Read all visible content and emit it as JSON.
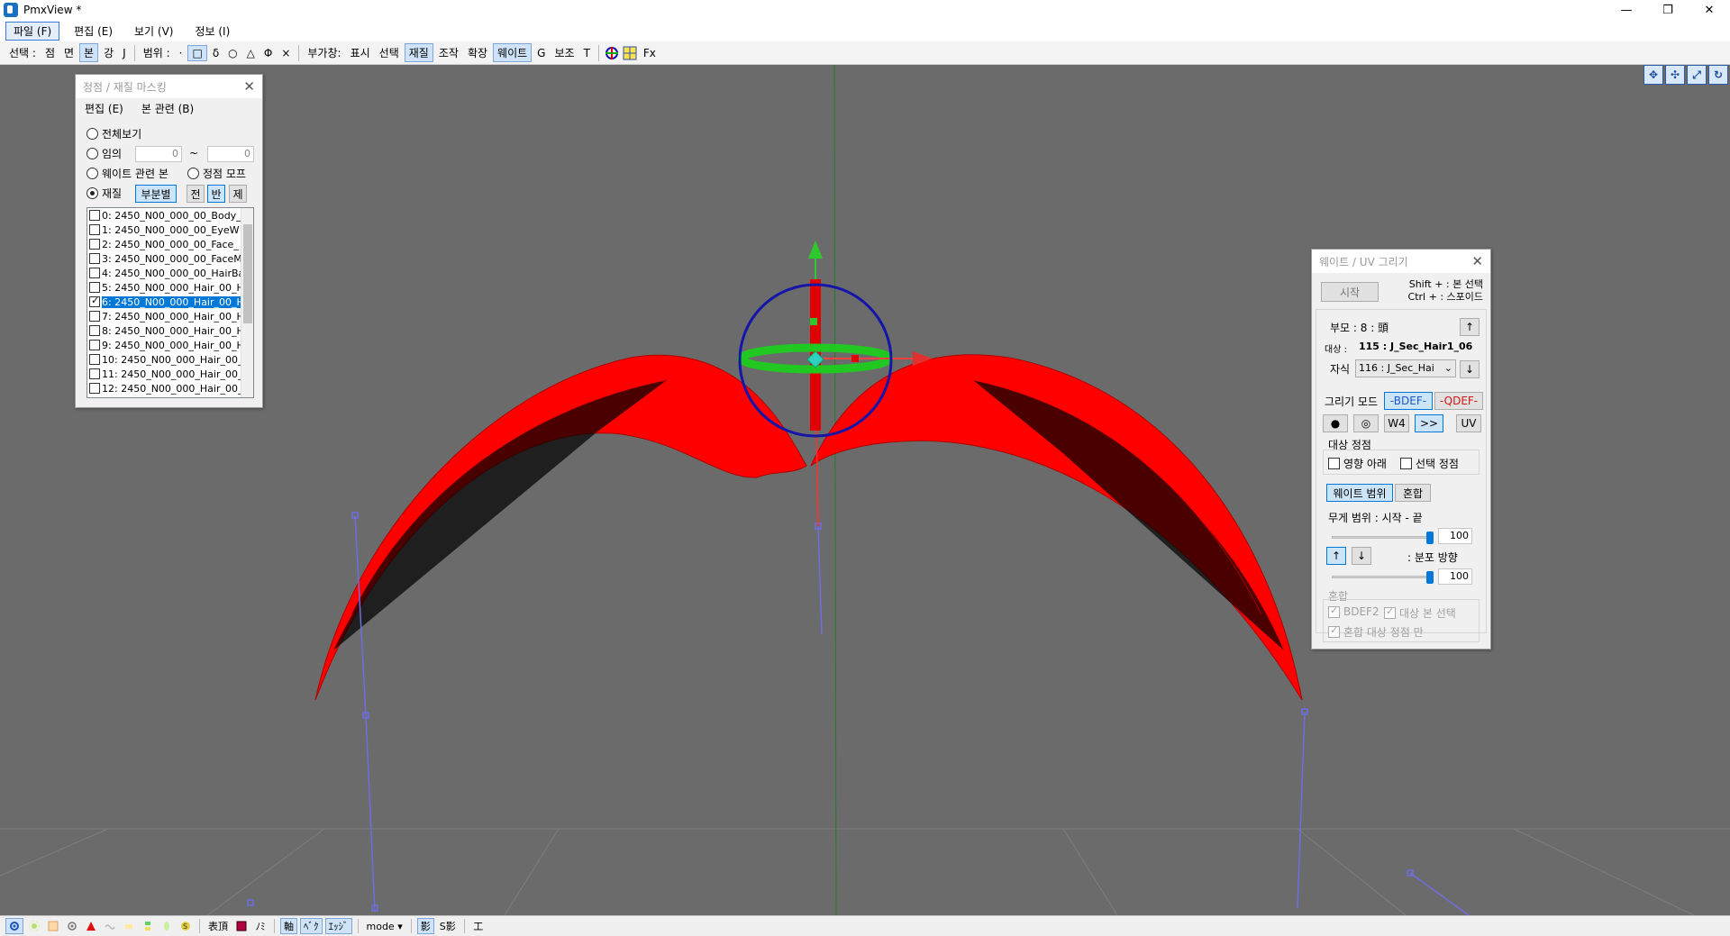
{
  "window": {
    "title": "PmxView *",
    "minimize": "—",
    "restore": "❐",
    "close": "✕"
  },
  "menu": [
    {
      "label": "파일 (F)"
    },
    {
      "label": "편집 (E)"
    },
    {
      "label": "보기 (V)"
    },
    {
      "label": "정보 (I)"
    }
  ],
  "toolbar": {
    "select_label": "선택 :",
    "vertex": "점",
    "face": "면",
    "bone": "본",
    "strong": "강",
    "j": "J",
    "range_label": "범위 :",
    "r_dot": "·",
    "r_box": "□",
    "r_delta": "δ",
    "r_circle": "○",
    "r_tri": "△",
    "r_phi": "Φ",
    "r_x": "×",
    "extra_label": "부가창:",
    "display": "표시",
    "selection": "선택",
    "material": "재질",
    "control": "조작",
    "expand": "확장",
    "weight": "웨이트",
    "g": "G",
    "assist": "보조",
    "t": "T",
    "fx": "Fx"
  },
  "mask_panel": {
    "title": "정점 / 재질 마스킹",
    "menu_edit": "편집 (E)",
    "menu_bone": "본 관련 (B)",
    "opt_all": "전체보기",
    "opt_range": "임의",
    "range_from": "0",
    "range_sep": "~",
    "range_to": "0",
    "opt_weight_bone": "웨이트 관련 본",
    "opt_vertex_morph": "정점 모프",
    "opt_material": "재질",
    "btn_partial": "부분별",
    "btn_all": "전",
    "btn_half": "반",
    "btn_remove": "제",
    "materials": [
      "0: 2450_N00_000_00_Body_",
      "1: 2450_N00_000_00_EyeW",
      "2: 2450_N00_000_00_Face_",
      "3: 2450_N00_000_00_FaceM",
      "4: 2450_N00_000_00_HairBa",
      "5: 2450_N00_000_Hair_00_H",
      "6: 2450_N00_000_Hair_00_H",
      "7: 2450_N00_000_Hair_00_H",
      "8: 2450_N00_000_Hair_00_H",
      "9: 2450_N00_000_Hair_00_H",
      "10: 2450_N00_000_Hair_00_",
      "11: 2450_N00_000_Hair_00_",
      "12: 2450_N00_000_Hair_00_"
    ]
  },
  "weight_panel": {
    "title": "웨이트 / UV 그리기",
    "btn_start": "시작",
    "hint1": "Shift + : 본 선택",
    "hint2": "Ctrl + : 스포이드",
    "parent": "부모 : 8 : 頭",
    "target_label": "대상 :",
    "target": "115 : J_Sec_Hair1_06",
    "child_label": "자식",
    "child": "116 : J_Sec_Hai",
    "up": "↑",
    "down": "↓",
    "draw_mode": "그리기 모드",
    "bdef": "-BDEF-",
    "qdef": "-QDEF-",
    "dot": "●",
    "target_dot": "◎",
    "w4": "W4",
    "next": ">>",
    "uv": "UV",
    "target_vertex": "대상 정점",
    "under_influence": "영향 아래",
    "selected_vertex": "선택 정점",
    "tab_weight_range": "웨이트 범위",
    "tab_blend": "혼합",
    "weight_range": "무게 범위 : 시작 - 끝",
    "val1": "100",
    "dist_dir": ": 분포 방향",
    "val2": "100",
    "blend_group": "혼합",
    "bdef2": "BDEF2",
    "target_bone_sel": "대상 본 선택",
    "blend_target_only": "혼합 대상 정점 만"
  },
  "status": {
    "s1": "表頂",
    "s2": "ﾉﾐ",
    "s3": "軸",
    "s4": "ﾍﾞｸ",
    "s5": "ｴｯｼﾞ",
    "mode": "mode ▾",
    "s6": "影",
    "s7": "S影",
    "s8": "工"
  },
  "colors": {
    "viewport": "#6b6b6b",
    "hair": "#ff0000",
    "gizmo_ring": "#1515a8",
    "gizmo_green": "#22c822",
    "bone_line": "#6e6ee0"
  }
}
